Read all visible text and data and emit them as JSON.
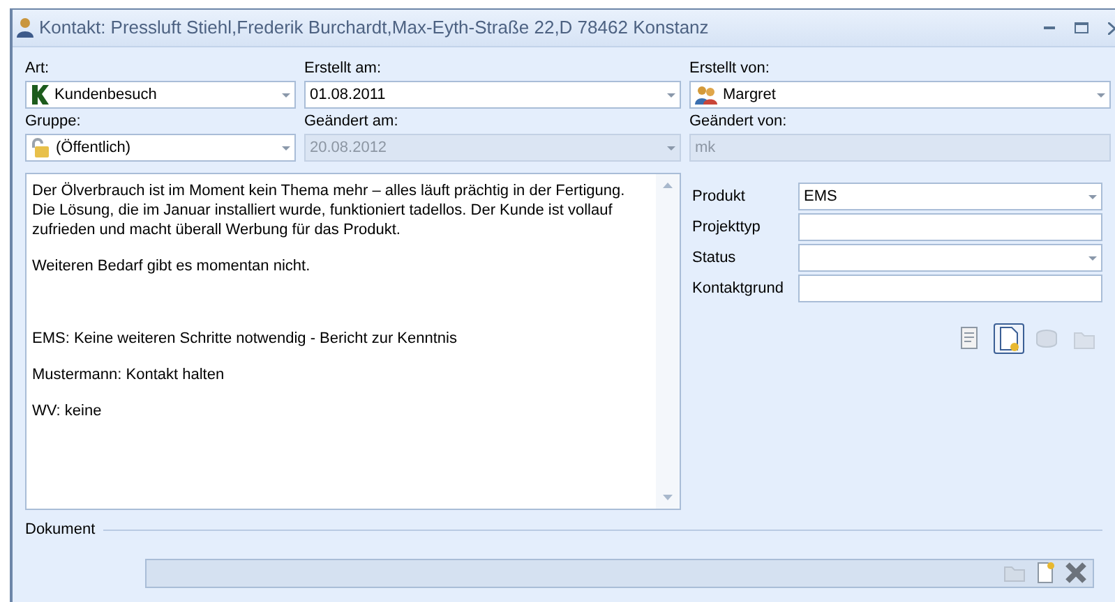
{
  "window": {
    "title": "Kontakt: Pressluft Stiehl,Frederik Burchardt,Max-Eyth-Straße 22,D 78462 Konstanz"
  },
  "header_fields": [
    {
      "label": "Art:",
      "value": "Kundenbesuch",
      "kind": "dropdown",
      "disabled": false
    },
    {
      "label": "Erstellt am:",
      "value": "01.08.2011",
      "kind": "dropdown",
      "disabled": false
    },
    {
      "label": "Erstellt von:",
      "value": "Margret",
      "kind": "dropdown",
      "disabled": false
    },
    {
      "label": "Gruppe:",
      "value": "(Öffentlich)",
      "kind": "dropdown",
      "disabled": false
    },
    {
      "label": "Geändert am:",
      "value": "20.08.2012",
      "kind": "dropdown",
      "disabled": true
    },
    {
      "label": "Geändert von:",
      "value": "mk",
      "kind": "text",
      "disabled": true
    }
  ],
  "notes": [
    "Der Ölverbrauch ist im Moment kein Thema mehr – alles läuft prächtig in der Fertigung. Die Lösung, die im Januar installiert wurde, funktioniert tadellos. Der Kunde ist vollauf zufrieden und macht überall Werbung für das Produkt.",
    "Weiteren Bedarf gibt es momentan nicht.",
    "EMS: Keine weiteren Schritte notwendig - Bericht zur Kenntnis",
    "Mustermann: Kontakt halten",
    "WV: keine"
  ],
  "properties": [
    {
      "label": "Produkt",
      "value": "EMS",
      "kind": "dropdown"
    },
    {
      "label": "Projekttyp",
      "kind": "text"
    },
    {
      "label": "Status",
      "kind": "dropdown"
    },
    {
      "label": "Kontaktgrund",
      "kind": "text"
    }
  ],
  "property_tools": [
    {
      "selected": false,
      "disabled": false
    },
    {
      "selected": true,
      "disabled": false
    },
    {
      "selected": false,
      "disabled": true
    },
    {
      "selected": false,
      "disabled": true
    }
  ],
  "document": {
    "label": "Dokument",
    "tools": [
      {
        "disabled": true
      },
      {
        "disabled": false
      },
      {
        "disabled": false
      }
    ]
  }
}
